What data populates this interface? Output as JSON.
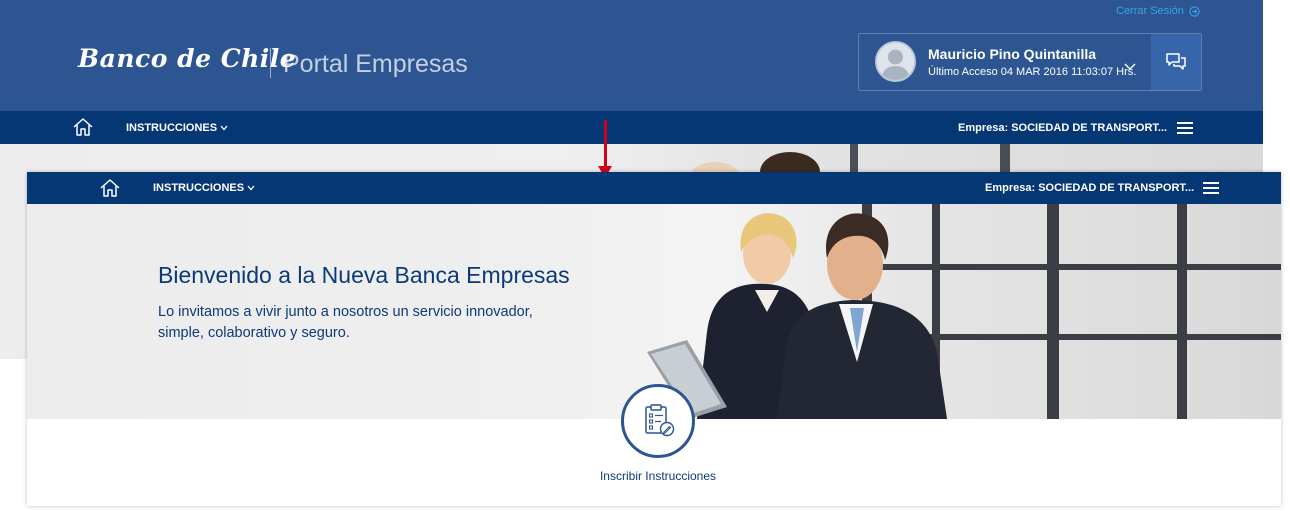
{
  "header": {
    "logout_label": "Cerrar Sesión",
    "brand": "Banco de Chile",
    "portal": "Portal Empresas"
  },
  "user": {
    "name": "Mauricio Pino Quintanilla",
    "last_access": "Último Acceso 04 MAR 2016 11:03:07 Hrs."
  },
  "nav": {
    "menu_label": "INSTRUCCIONES",
    "company_label": "Empresa:",
    "company_value": "SOCIEDAD DE TRANSPORT..."
  },
  "hero": {
    "title": "Bienvenido a la Nueva Banca Empresas",
    "text": "Lo invitamos a vivir junto a nosotros un servicio innovador, simple, colaborativo y seguro."
  },
  "actions": [
    {
      "label": "Inscribir Instrucciones",
      "icon": "clipboard-edit-icon"
    }
  ],
  "colors": {
    "header_blue": "#2c5592",
    "nav_blue": "#053775",
    "text_blue": "#0b3a7a",
    "link_cyan": "#3aa4e0",
    "arrow_red": "#d0021b"
  }
}
